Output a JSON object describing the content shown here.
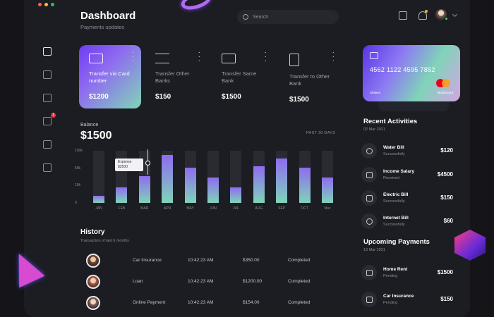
{
  "colors": {
    "accent_start": "#6e3cf2",
    "accent_end": "#7fd4b8",
    "bg": "#1c1d22",
    "panel": "#2a2b32"
  },
  "window_dots": [
    "#ff5f57",
    "#febc2e",
    "#28c840"
  ],
  "header": {
    "title": "Dashboard",
    "subtitle": "Payments updates",
    "search_placeholder": "Search"
  },
  "sidebar": {
    "items": [
      {
        "icon": "home-icon",
        "active": true
      },
      {
        "icon": "monitor-icon",
        "active": false
      },
      {
        "icon": "clipboard-icon",
        "active": false
      },
      {
        "icon": "image-icon",
        "active": false,
        "badge": "1"
      },
      {
        "icon": "trophy-icon",
        "active": false
      },
      {
        "icon": "document-icon",
        "active": false
      }
    ]
  },
  "transfers": [
    {
      "label": "Transfer via Card number",
      "amount": "$1200",
      "icon": "credit-card-icon",
      "active": true
    },
    {
      "label": "Transfer Other Banks",
      "amount": "$150",
      "icon": "arrows-icon",
      "active": false
    },
    {
      "label": "Transfer Same Bank",
      "amount": "$1500",
      "icon": "bank-icon",
      "active": false
    },
    {
      "label": "Transfer to Other Bank",
      "amount": "$1500",
      "icon": "receipt-icon",
      "active": false
    }
  ],
  "card": {
    "number": "4562 1122 4595 7852",
    "holder": "Shalem",
    "brand": "Mastercard"
  },
  "balance": {
    "label": "Balance",
    "value": "$1500",
    "period": "PAST 30 DAYS"
  },
  "chart_data": {
    "type": "bar",
    "categories": [
      "JAN",
      "FEB",
      "MAR",
      "APR",
      "MAY",
      "JUN",
      "JUL",
      "AUG",
      "SEP",
      "OCT",
      "Nov"
    ],
    "values": [
      14,
      30,
      52,
      92,
      68,
      48,
      30,
      70,
      85,
      68,
      48
    ],
    "ylim": [
      0,
      100
    ],
    "y_ticks": [
      "100k",
      "50k",
      "10k",
      "0"
    ],
    "tooltip": {
      "label": "Expense",
      "value": "$2500",
      "category": "MAR"
    },
    "grid": false
  },
  "history": {
    "title": "History",
    "subtitle": "Transaction of last 6 months",
    "rows": [
      {
        "name": "Car Insurance",
        "time": "10:42:23 AM",
        "amount": "$350.00",
        "status": "Completed"
      },
      {
        "name": "Loan",
        "time": "10:42:23 AM",
        "amount": "$1200.00",
        "status": "Completed"
      },
      {
        "name": "Online Payment",
        "time": "10:42:23 AM",
        "amount": "$154.00",
        "status": "Completed"
      }
    ]
  },
  "recent": {
    "title": "Recent Activities",
    "date": "02 Mar 2021",
    "items": [
      {
        "name": "Water Bill",
        "status": "Successfully",
        "amount": "$120",
        "icon": "water-icon"
      },
      {
        "name": "Income Salary",
        "status": "Received",
        "amount": "$4500",
        "icon": "wallet-icon"
      },
      {
        "name": "Electric Bill",
        "status": "Successfully",
        "amount": "$150",
        "icon": "lightning-icon"
      },
      {
        "name": "Internet Bill",
        "status": "Successfully",
        "amount": "$60",
        "icon": "wifi-icon"
      }
    ]
  },
  "upcoming": {
    "title": "Upcoming Payments",
    "date": "13 Mar 2021",
    "items": [
      {
        "name": "Home Rent",
        "status": "Pending",
        "amount": "$1500",
        "icon": "home-icon"
      },
      {
        "name": "Car Insurance",
        "status": "Pending",
        "amount": "$150",
        "icon": "car-icon"
      }
    ]
  }
}
